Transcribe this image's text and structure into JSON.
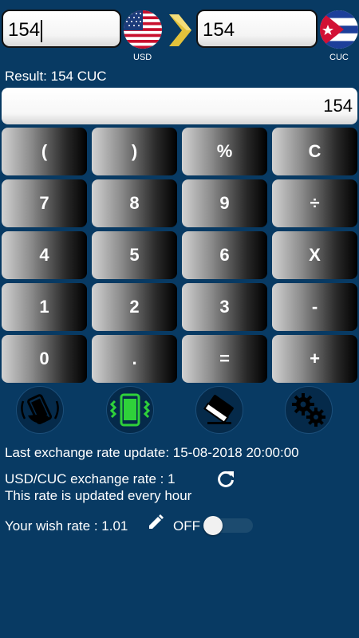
{
  "converter": {
    "from_amount": "154",
    "to_amount": "154",
    "from_currency": "USD",
    "to_currency": "CUC",
    "arrow_icon": "chevron-right-icon",
    "arrow_color": "#e2c23b"
  },
  "result_label": "Result: 154 CUC",
  "display_value": "154",
  "keypad": {
    "keys": [
      "(",
      ")",
      "%",
      "C",
      "7",
      "8",
      "9",
      "÷",
      "4",
      "5",
      "6",
      "X",
      "1",
      "2",
      "3",
      "-",
      "0",
      ".",
      "=",
      "+"
    ]
  },
  "tools": [
    {
      "icon": "shake-phone-icon"
    },
    {
      "icon": "vibrate-phone-icon",
      "color": "#2fd13a"
    },
    {
      "icon": "eraser-icon"
    },
    {
      "icon": "gears-icon"
    }
  ],
  "info": {
    "last_update": "Last exchange rate update: 15-08-2018 20:00:00",
    "exchange_rate": "USD/CUC exchange rate : 1",
    "update_frequency": "This rate is updated every hour",
    "wish_rate": "Your wish rate : 1.01",
    "toggle_label": "OFF"
  },
  "colors": {
    "background": "#083a63",
    "text": "#ffffff"
  }
}
